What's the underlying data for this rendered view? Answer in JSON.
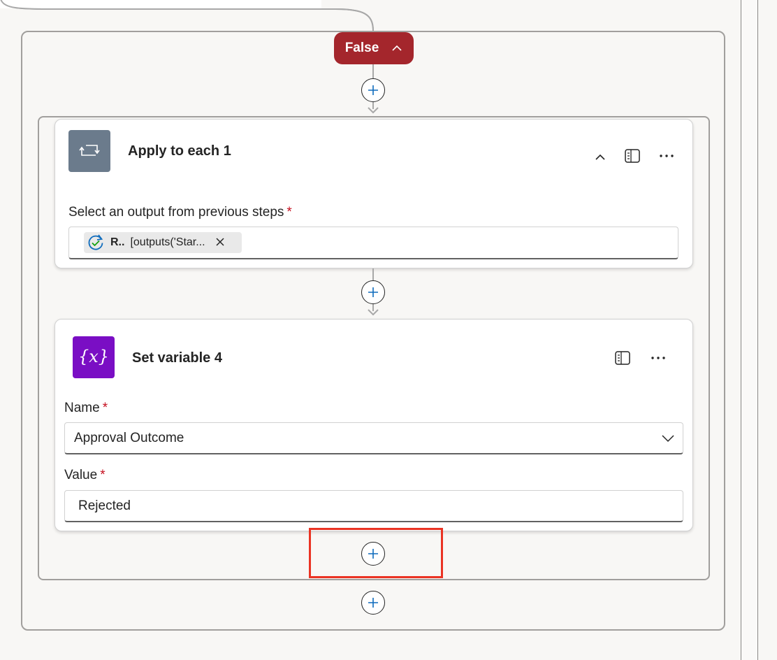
{
  "branch": {
    "label": "False",
    "collapse_icon": "chevron-up-icon",
    "color": "#a4262c"
  },
  "apply_to_each": {
    "title": "Apply to each 1",
    "icon": "loop-icon",
    "tile_color": "#6b7b8c",
    "field_label": "Select an output from previous steps",
    "required_mark": "*",
    "token": {
      "icon": "approval-icon",
      "short_label": "R..",
      "expression": "[outputs('Star...",
      "remove_icon": "close-icon"
    }
  },
  "set_variable": {
    "title": "Set variable 4",
    "icon": "variable-icon",
    "tile_color": "#7a0ec4",
    "name_label": "Name",
    "name_value": "Approval Outcome",
    "value_label": "Value",
    "value_value": "Rejected",
    "required_mark": "*"
  },
  "menu_icon": "more-horizontal-icon",
  "panel_icon": "side-panel-icon",
  "add_step_icon": "add-circle-icon",
  "accent_color": "#0f6cbd",
  "highlight_color": "#ea3323"
}
